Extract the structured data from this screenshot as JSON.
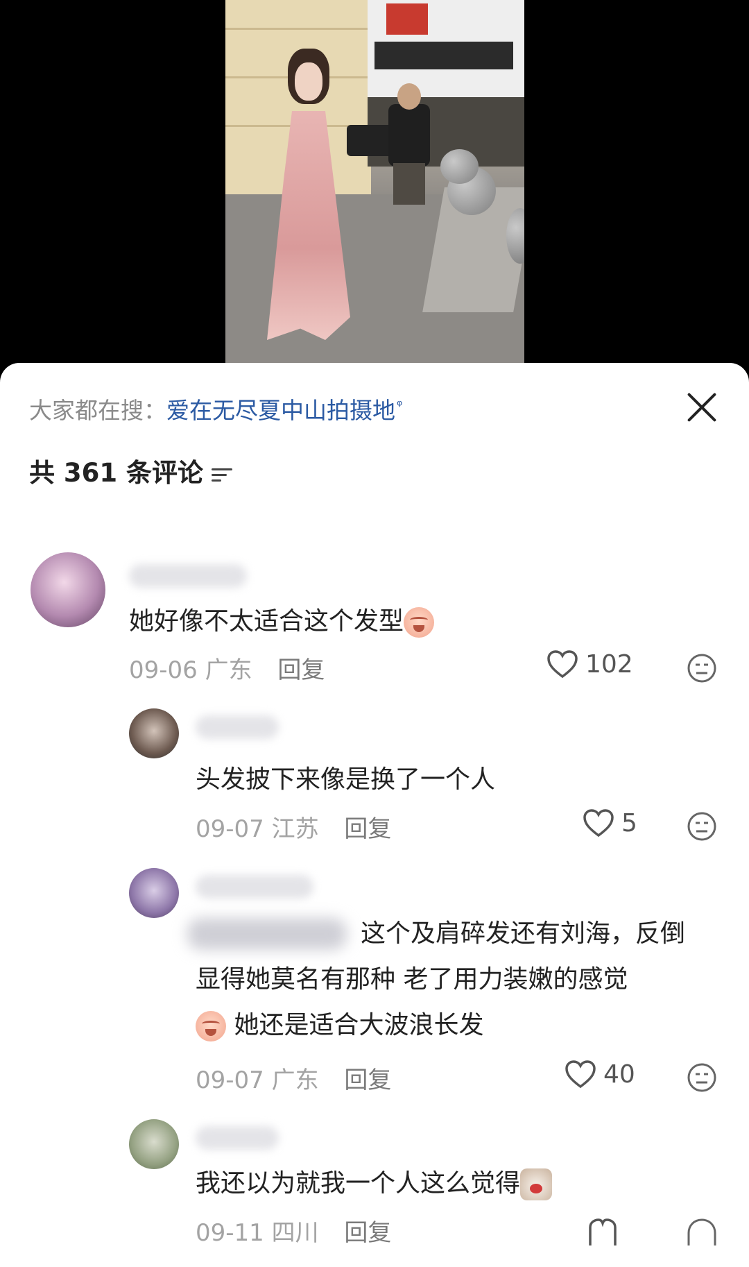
{
  "search_bar": {
    "prefix": "大家都在搜：",
    "query": "爱在无尽夏中山拍摄地",
    "search_glyph": "ᵠ"
  },
  "comments_header": {
    "count_text": "共 361 条评论"
  },
  "comments": [
    {
      "text": "她好像不太适合这个发型",
      "date": "09-06",
      "location": "广东",
      "reply_label": "回复",
      "likes": "102"
    },
    {
      "text": "头发披下来像是换了一个人",
      "date": "09-07",
      "location": "江苏",
      "reply_label": "回复",
      "likes": "5"
    },
    {
      "text_line1": "这个及肩碎发还有刘海，反倒",
      "text_line2": "显得她莫名有那种 老了用力装嫩的感觉",
      "text_line3": "她还是适合大波浪长发",
      "date": "09-07",
      "location": "广东",
      "reply_label": "回复",
      "likes": "40"
    },
    {
      "text": "我还以为就我一个人这么觉得",
      "date": "09-11",
      "location": "四川",
      "reply_label": "回复"
    }
  ],
  "colors": {
    "link_blue": "#2b5aa3",
    "meta_gray": "#a3a3a3",
    "text_dark": "#222222"
  },
  "icons": [
    "close-icon",
    "sort-icon",
    "heart-icon",
    "dislike-face-icon",
    "search-icon"
  ]
}
